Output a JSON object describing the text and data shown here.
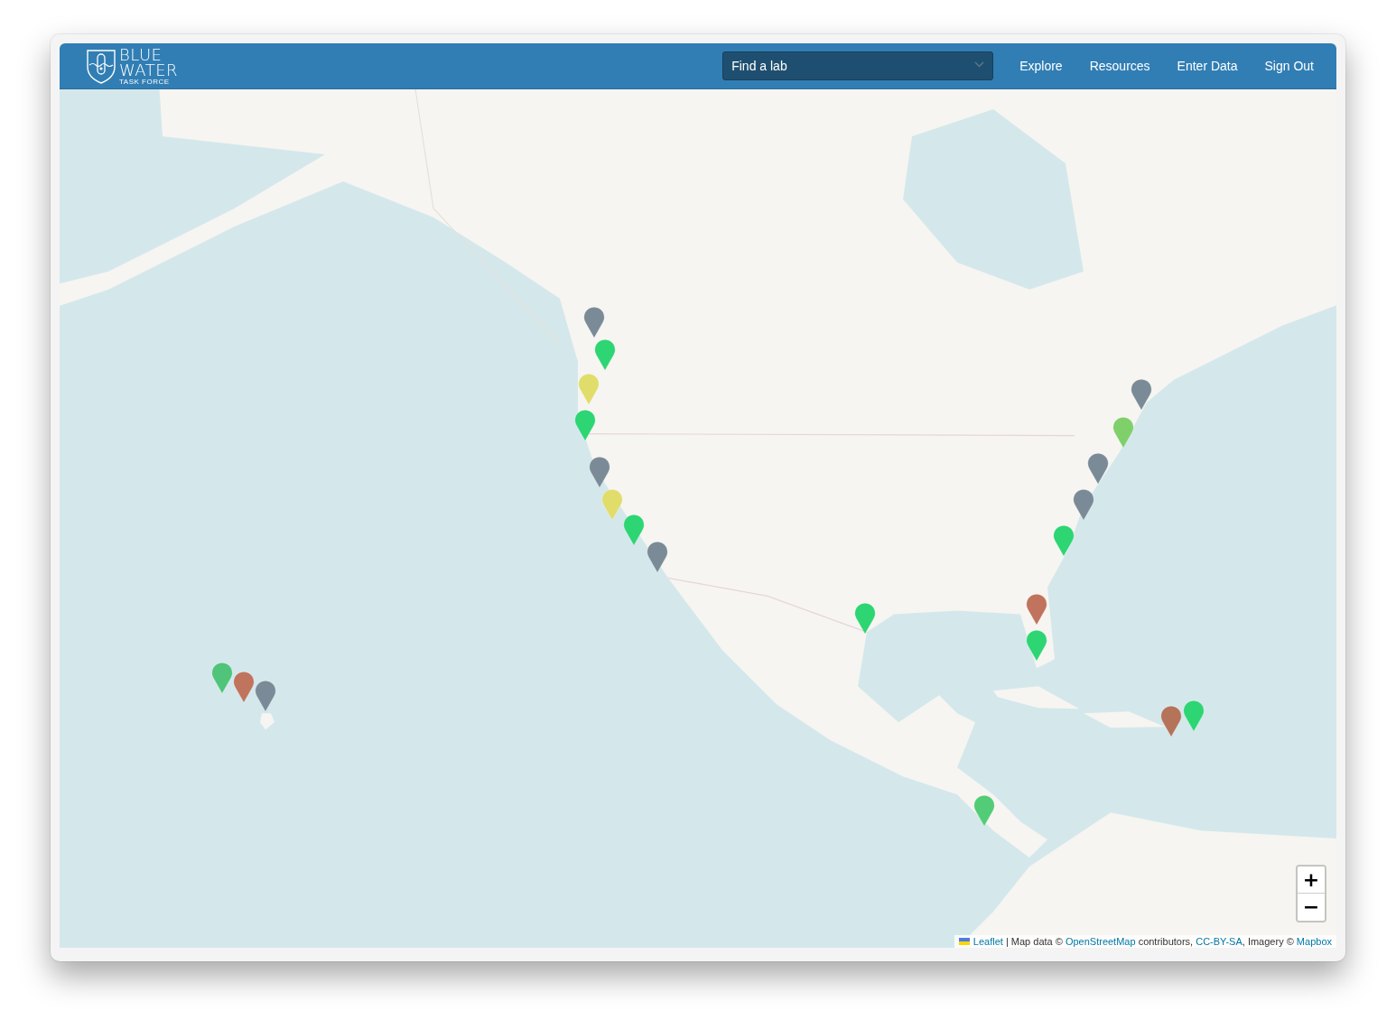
{
  "header": {
    "logo": {
      "line_1": "BLUE",
      "line_2": "WATER",
      "tagline": "TASK FORCE"
    },
    "lab_select": {
      "placeholder": "Find a lab"
    },
    "nav": [
      "Explore",
      "Resources",
      "Enter Data",
      "Sign Out"
    ]
  },
  "map": {
    "kind": "picture",
    "markers": [
      {
        "color": "#7a8b97"
      },
      {
        "color": "#2ed573"
      },
      {
        "color": "#e0dd6a"
      },
      {
        "color": "#2ed573"
      },
      {
        "color": "#7a8b97"
      },
      {
        "color": "#e0dd6a"
      },
      {
        "color": "#2ed573"
      },
      {
        "color": "#7a8b97"
      },
      {
        "color": "#4fc47a"
      },
      {
        "color": "#c0735d"
      },
      {
        "color": "#7a8b97"
      },
      {
        "color": "#2ed573"
      },
      {
        "color": "#c0735d"
      },
      {
        "color": "#2ed573"
      },
      {
        "color": "#7a8b97"
      },
      {
        "color": "#7fd06a"
      },
      {
        "color": "#7a8b97"
      },
      {
        "color": "#7a8b97"
      },
      {
        "color": "#2ed573"
      },
      {
        "color": "#b5735a"
      },
      {
        "color": "#2ed573"
      },
      {
        "color": "#52cc76"
      }
    ],
    "zoom_controls": [
      "+",
      "−"
    ],
    "attribution": [
      {
        "kind": "link",
        "text": "Leaflet"
      },
      {
        "kind": "text",
        "text": " | Map data © "
      },
      {
        "kind": "link",
        "text": "OpenStreetMap"
      },
      {
        "kind": "text",
        "text": " contributors, "
      },
      {
        "kind": "link",
        "text": "CC-BY-SA"
      },
      {
        "kind": "text",
        "text": ", Imagery © "
      },
      {
        "kind": "link",
        "text": "Mapbox"
      }
    ]
  }
}
